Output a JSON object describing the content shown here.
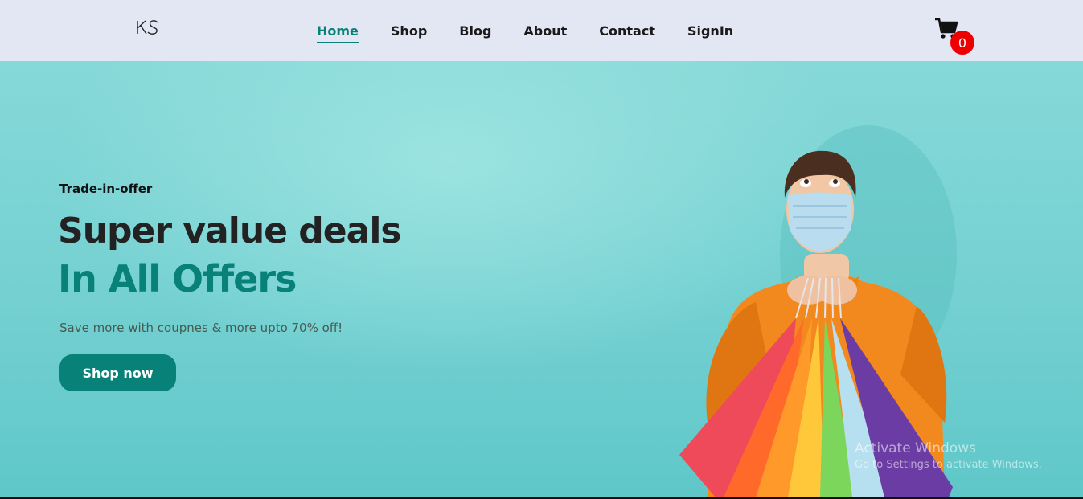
{
  "brand": {
    "logo_text": "KS"
  },
  "nav": {
    "items": [
      {
        "label": "Home",
        "active": true
      },
      {
        "label": "Shop",
        "active": false
      },
      {
        "label": "Blog",
        "active": false
      },
      {
        "label": "About",
        "active": false
      },
      {
        "label": "Contact",
        "active": false
      },
      {
        "label": "SignIn",
        "active": false
      }
    ]
  },
  "cart": {
    "icon": "cart-icon",
    "count": "0"
  },
  "hero": {
    "kicker": "Trade-in-offer",
    "headline": "Super value deals",
    "headline_accent": "In All Offers",
    "tagline": "Save more with coupnes & more upto 70% off!",
    "cta_label": "Shop now",
    "image": "man-with-shopping-bags"
  },
  "watermark": {
    "title": "Activate Windows",
    "subtitle": "Go to Settings to activate Windows."
  },
  "colors": {
    "accent": "#088178",
    "header_bg": "#e3e6f3",
    "hero_bg": "#7fd6d5",
    "badge": "#ee0000"
  }
}
